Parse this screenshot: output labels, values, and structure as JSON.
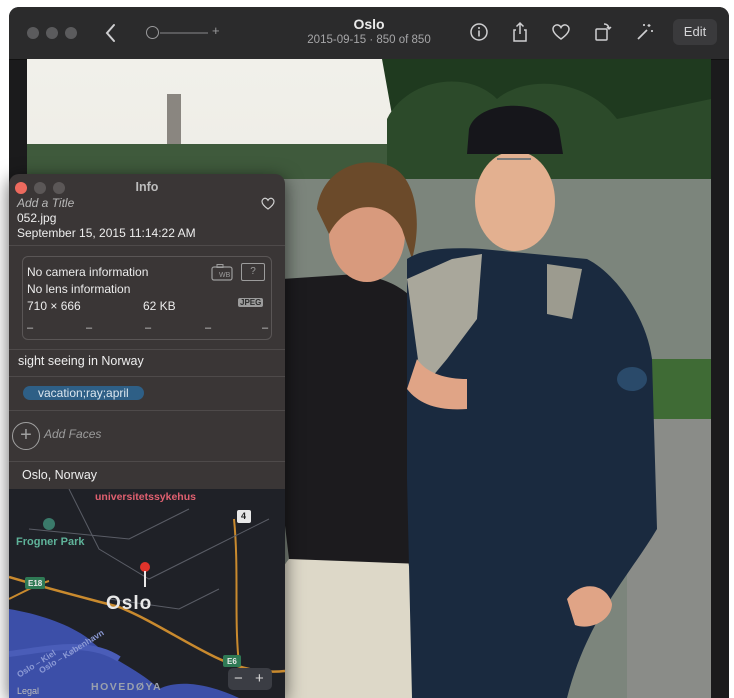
{
  "toolbar": {
    "title": "Oslo",
    "date": "2015-09-15",
    "separator": "·",
    "position": "850 of 850",
    "slider_plus": "+",
    "edit_label": "Edit"
  },
  "info_panel": {
    "title": "Info",
    "add_title_placeholder": "Add a Title",
    "filename": "052.jpg",
    "date_time": "September 15, 2015   11:14:22 AM",
    "camera": "No camera information",
    "lens": "No lens information",
    "dimensions": "710 × 666",
    "file_size": "62 KB",
    "format_badge": "JPEG",
    "wb_badge": "WB",
    "unknown_badge": "?",
    "exif_dashes": [
      "–",
      "–",
      "–",
      "–",
      "–"
    ],
    "caption": "sight seeing in Norway",
    "keywords": "vacation;ray;april",
    "add_faces": "Add Faces",
    "location": "Oslo, Norway"
  },
  "map": {
    "city_label": "Oslo",
    "hospital_label": "universitetssykehus",
    "park_label": "Frogner Park",
    "road_e18": "E18",
    "road_e6": "E6",
    "road_4": "4",
    "ferry_kiel": "Oslo – Kiel",
    "ferry_kbh": "Oslo – København",
    "island_label": "HOVEDØYA",
    "legal": "Legal",
    "zoom_out": "−",
    "zoom_in": "+"
  },
  "colors": {
    "accent_keyword": "#2e5f86",
    "close_red": "#ed6a5e",
    "map_water": "#3c4fa8",
    "map_roads": "#c98a2e",
    "pin_red": "#e0332b"
  }
}
